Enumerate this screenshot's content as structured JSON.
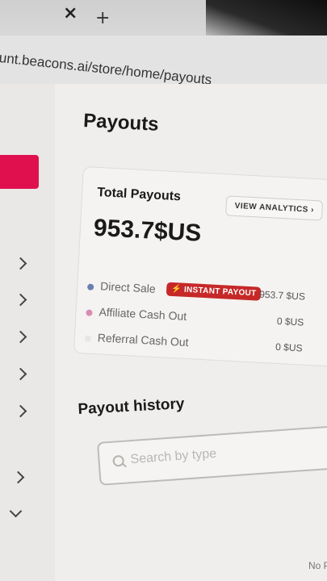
{
  "browser": {
    "url": "unt.beacons.ai/store/home/payouts",
    "close_glyph": "×",
    "new_tab_glyph": "+"
  },
  "page": {
    "title": "Payouts"
  },
  "total_card": {
    "title": "Total Payouts",
    "analytics_label": "VIEW ANALYTICS",
    "analytics_chevron": "›",
    "amount": "953.7$US",
    "rows": [
      {
        "label": "Direct Sale",
        "badge": "⚡ INSTANT PAYOUT",
        "amount": "953.7 $US",
        "dot_color": "#6b7fb0"
      },
      {
        "label": "Affiliate Cash Out",
        "amount": "0 $US",
        "dot_color": "#d98cb3"
      },
      {
        "label": "Referral Cash Out",
        "amount": "0 $US",
        "dot_color": "#e8e6e3"
      }
    ]
  },
  "history": {
    "title": "Payout history",
    "search_placeholder": "Search by type"
  },
  "corner_text": "No P",
  "colors": {
    "accent": "#e0104e",
    "badge": "#c62828"
  }
}
